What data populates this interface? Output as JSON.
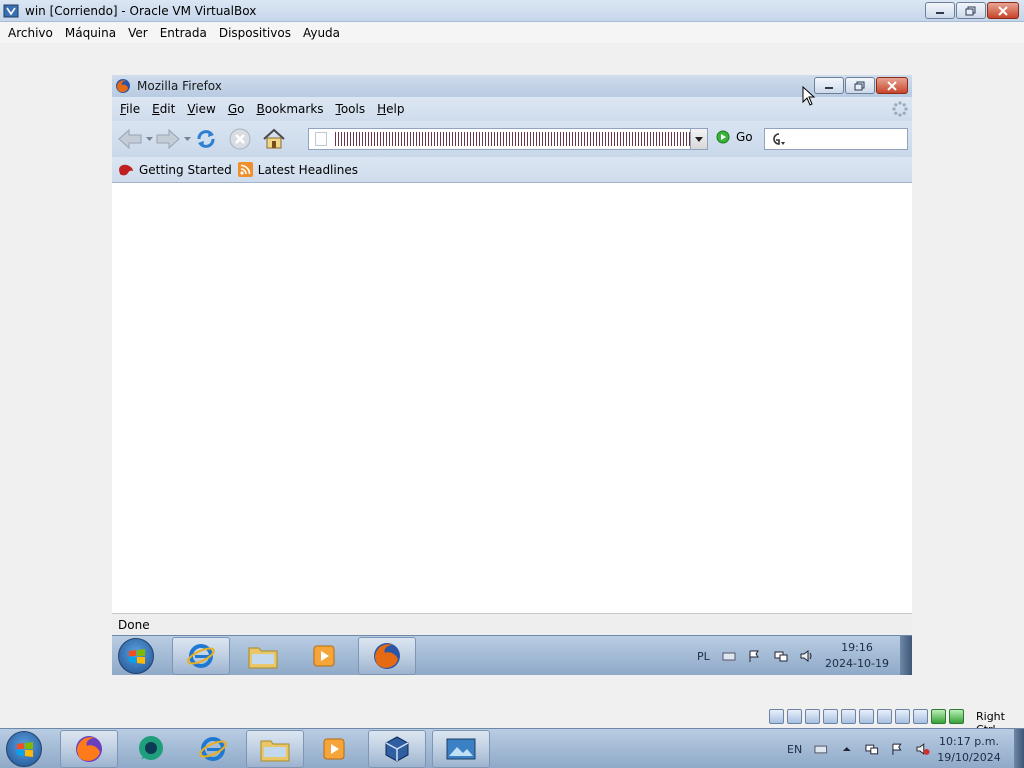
{
  "host_window": {
    "title": "win [Corriendo] - Oracle VM VirtualBox",
    "menu": [
      "Archivo",
      "Máquina",
      "Ver",
      "Entrada",
      "Dispositivos",
      "Ayuda"
    ]
  },
  "firefox": {
    "title": "Mozilla Firefox",
    "menu": [
      "File",
      "Edit",
      "View",
      "Go",
      "Bookmarks",
      "Tools",
      "Help"
    ],
    "url_value": "",
    "go_label": "Go",
    "search_value": "",
    "bookmarks": [
      "Getting Started",
      "Latest Headlines"
    ],
    "status": "Done"
  },
  "guest_taskbar": {
    "lang": "PL",
    "time": "19:16",
    "date": "2024-10-19"
  },
  "vbox_status": {
    "host_key": "Right Ctrl"
  },
  "host_taskbar": {
    "lang": "EN",
    "time": "10:17 p.m.",
    "date": "19/10/2024"
  },
  "colors": {
    "title_bar": "#c6d6ea",
    "close_button": "#c7452b",
    "taskbar": "#8fa9c8"
  }
}
